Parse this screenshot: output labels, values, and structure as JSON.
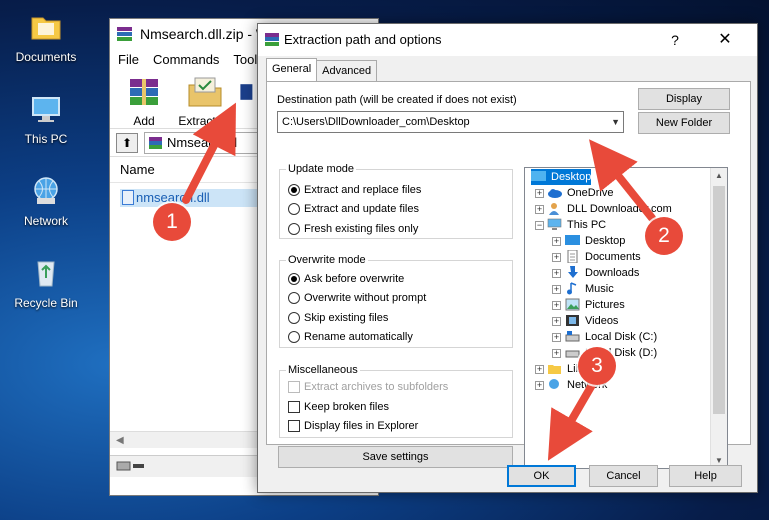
{
  "desktop": {
    "icons": [
      {
        "label": "Documents",
        "icon": "folder-icon"
      },
      {
        "label": "This PC",
        "icon": "computer-icon"
      },
      {
        "label": "Network",
        "icon": "network-icon"
      },
      {
        "label": "Recycle Bin",
        "icon": "recycle-bin-icon"
      }
    ]
  },
  "rar": {
    "title": "Nmsearch.dll.zip - W",
    "menu": [
      "File",
      "Commands",
      "Tools"
    ],
    "tools": [
      {
        "label": "Add",
        "icon": "add-archive-icon"
      },
      {
        "label": "Extract To",
        "icon": "extract-icon"
      }
    ],
    "path": "Nmsearch.d",
    "column_name": "Name",
    "file": "nmsearch.dll"
  },
  "dialog": {
    "title": "Extraction path and options",
    "help": "?",
    "close": "✕",
    "tabs": [
      "General",
      "Advanced"
    ],
    "dest_label": "Destination path (will be created if does not exist)",
    "dest_value": "C:\\Users\\DllDownloader_com\\Desktop",
    "display_btn": "Display",
    "new_folder_btn": "New Folder",
    "update_mode": {
      "title": "Update mode",
      "options": [
        "Extract and replace files",
        "Extract and update files",
        "Fresh existing files only"
      ],
      "selected": 0
    },
    "overwrite_mode": {
      "title": "Overwrite mode",
      "options": [
        "Ask before overwrite",
        "Overwrite without prompt",
        "Skip existing files",
        "Rename automatically"
      ],
      "selected": 0
    },
    "misc": {
      "title": "Miscellaneous",
      "options": [
        "Extract archives to subfolders",
        "Keep broken files",
        "Display files in Explorer"
      ]
    },
    "save_settings": "Save settings",
    "tree": [
      "Desktop",
      "OneDrive",
      "DLL Downloader.com",
      "This PC",
      "Desktop",
      "Documents",
      "Downloads",
      "Music",
      "Pictures",
      "Videos",
      "Local Disk (C:)",
      "Local Disk (D:)",
      "Libraries",
      "Network"
    ],
    "ok": "OK",
    "cancel": "Cancel",
    "help_btn": "Help"
  },
  "callouts": [
    "1",
    "2",
    "3"
  ],
  "colors": {
    "arrow": "#e84a3a",
    "selection": "#0078d7",
    "desktop": "#0c3f86"
  }
}
